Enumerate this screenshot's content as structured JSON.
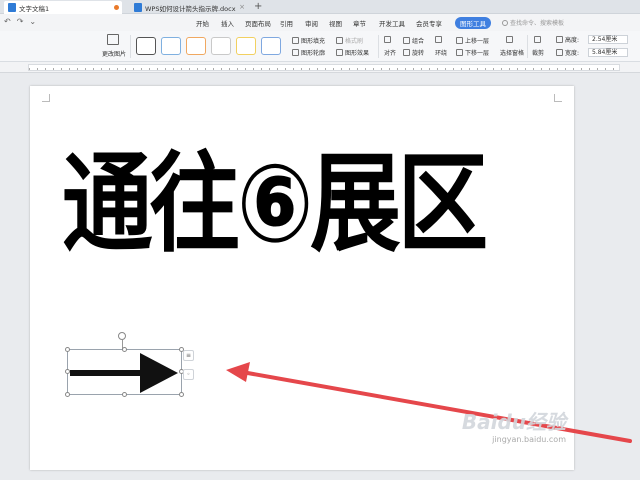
{
  "tabs": [
    {
      "label": "文字文稿1",
      "active": true
    },
    {
      "label": "WPS如何设计箭头指示牌.docx",
      "active": false
    }
  ],
  "menu": {
    "items": [
      "开始",
      "插入",
      "页面布局",
      "引用",
      "审阅",
      "视图",
      "章节",
      "开发工具",
      "会员专享"
    ],
    "active_item": "图形工具",
    "search_placeholder": "查找命令、搜索模板"
  },
  "ribbon": {
    "change_picture": "更改图片",
    "fill": "图形填充",
    "outline": "图形轮廓",
    "style_brush": "格式刷",
    "effects": "图形效果",
    "align": "对齐",
    "group": "组合",
    "rotate": "旋转",
    "bring_forward": "上移一层",
    "send_backward": "下移一层",
    "wrap": "环绕",
    "selection_pane": "选择窗格",
    "crop": "裁剪",
    "height_label": "高度:",
    "height_value": "2.54厘米",
    "width_label": "宽度:",
    "width_value": "5.84厘米"
  },
  "document": {
    "sign_text": "通往⑥展区"
  },
  "watermark": {
    "main": "Baidu经验",
    "sub": "jingyan.baidu.com"
  },
  "colors": {
    "accent": "#3f7fe0",
    "annotation_arrow": "#e5474b",
    "swatches": [
      "#666666",
      "#7fb0e0",
      "#f0a860",
      "#c9c9c9",
      "#f2d060",
      "#7fa8e0"
    ]
  }
}
